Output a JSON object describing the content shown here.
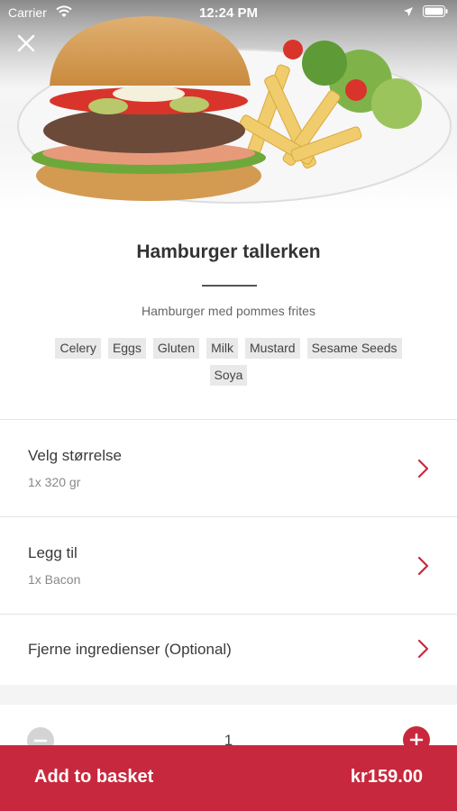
{
  "status_bar": {
    "carrier": "Carrier",
    "time": "12:24 PM"
  },
  "product": {
    "title": "Hamburger tallerken",
    "description": "Hamburger med pommes frites",
    "allergens": [
      "Celery",
      "Eggs",
      "Gluten",
      "Milk",
      "Mustard",
      "Sesame Seeds",
      "Soya"
    ]
  },
  "options": [
    {
      "label": "Velg størrelse",
      "value": "1x 320 gr"
    },
    {
      "label": "Legg til",
      "value": "1x Bacon"
    },
    {
      "label": "Fjerne ingredienser (Optional)",
      "value": ""
    }
  ],
  "quantity": "1",
  "basket": {
    "label": "Add to basket",
    "price": "kr159.00"
  },
  "colors": {
    "accent": "#c8283d",
    "chip_bg": "#e9e9e9"
  }
}
